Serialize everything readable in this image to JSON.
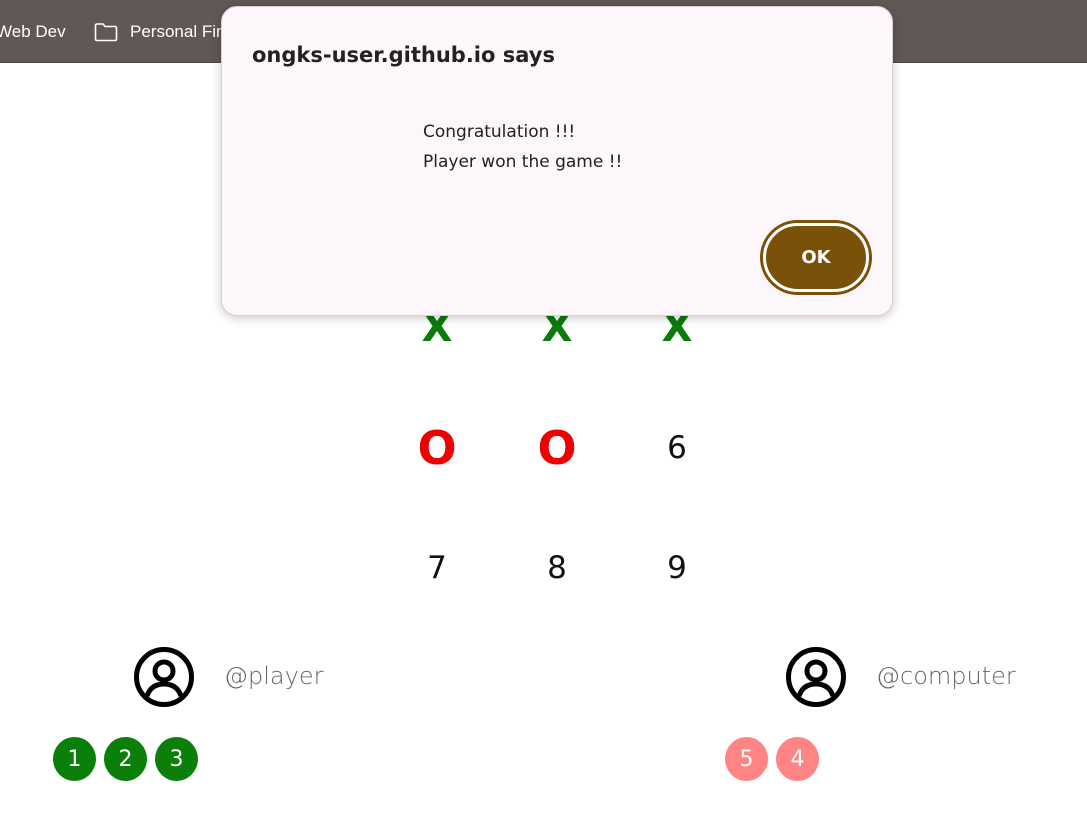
{
  "bookmarks": {
    "items": [
      {
        "label": "Web Dev",
        "icon": "folder-icon"
      },
      {
        "label": "Personal Fin",
        "icon": "folder-icon"
      }
    ]
  },
  "board": {
    "cells": [
      "X",
      "X",
      "X",
      "O",
      "O",
      "6",
      "7",
      "8",
      "9"
    ],
    "colors": {
      "x": "#0a7c0a",
      "o": "#ef0000"
    }
  },
  "player": {
    "handle": "@player",
    "moves": [
      "1",
      "2",
      "3"
    ],
    "color": "#0a800a"
  },
  "computer": {
    "handle": "@computer",
    "moves": [
      "5",
      "4"
    ],
    "color": "#ff8585"
  },
  "dialog": {
    "title": "ongks-user.github.io says",
    "message_line1": "Congratulation !!!",
    "message_line2": "Player won the game !!",
    "ok_label": "OK",
    "accent": "#7a5108"
  }
}
